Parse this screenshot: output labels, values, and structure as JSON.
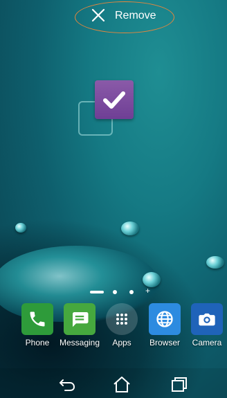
{
  "remove_bar": {
    "label": "Remove",
    "icon": "close-icon",
    "highlight_color": "#e6863c"
  },
  "dragged_item": {
    "icon": "check-icon",
    "color": "#7a489c"
  },
  "page_indicator": {
    "pages": 4,
    "current": 1
  },
  "dock": {
    "items": [
      {
        "label": "Phone",
        "icon": "phone-icon",
        "color": "#2e9b3a"
      },
      {
        "label": "Messaging",
        "icon": "message-icon",
        "color": "#46a83e"
      },
      {
        "label": "Apps",
        "icon": "apps-grid-icon",
        "color": "#ffffff"
      },
      {
        "label": "Browser",
        "icon": "globe-icon",
        "color": "#2d8be0"
      },
      {
        "label": "Camera",
        "icon": "camera-icon",
        "color": "#1f63b9"
      }
    ]
  },
  "nav": {
    "back_icon": "back-icon",
    "home_icon": "home-icon",
    "recents_icon": "recents-icon"
  }
}
